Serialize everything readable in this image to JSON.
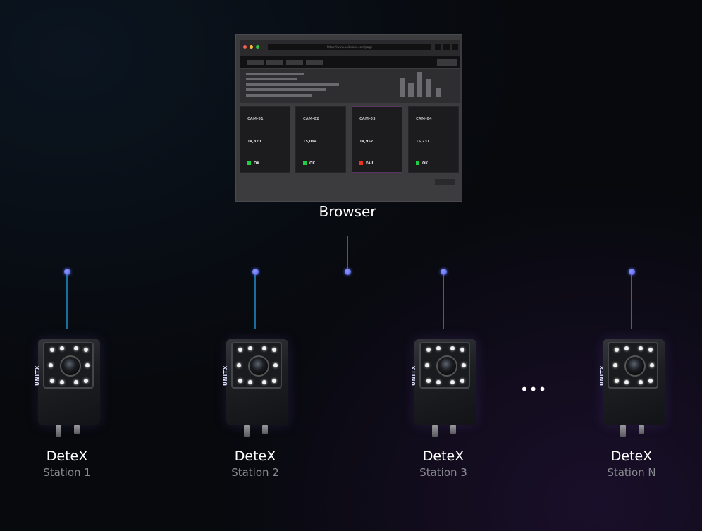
{
  "browser": {
    "url": "https://www.unitxlabs.com/page",
    "cards": [
      {
        "label": "CAM-01",
        "count": "14,820",
        "status": "OK",
        "status_color": "#22cc44"
      },
      {
        "label": "CAM-02",
        "count": "15,094",
        "status": "OK",
        "status_color": "#22cc44"
      },
      {
        "label": "CAM-03",
        "count": "14,957",
        "status": "FAIL",
        "status_color": "#ee3322"
      },
      {
        "label": "CAM-04",
        "count": "15,231",
        "status": "OK",
        "status_color": "#22cc44"
      }
    ]
  },
  "browser_label": "Browser",
  "line_colors": {
    "cyan": "#1f8fd0",
    "purple": "#7a3fd0"
  },
  "cameras": [
    {
      "name": "DeteX",
      "station": "Station 1",
      "logo": "UNITX"
    },
    {
      "name": "DeteX",
      "station": "Station 2",
      "logo": "UNITX"
    },
    {
      "name": "DeteX",
      "station": "Station 3",
      "logo": "UNITX"
    },
    {
      "name": "DeteX",
      "station": "Station N",
      "logo": "UNITX"
    }
  ],
  "ellipsis": "•••"
}
